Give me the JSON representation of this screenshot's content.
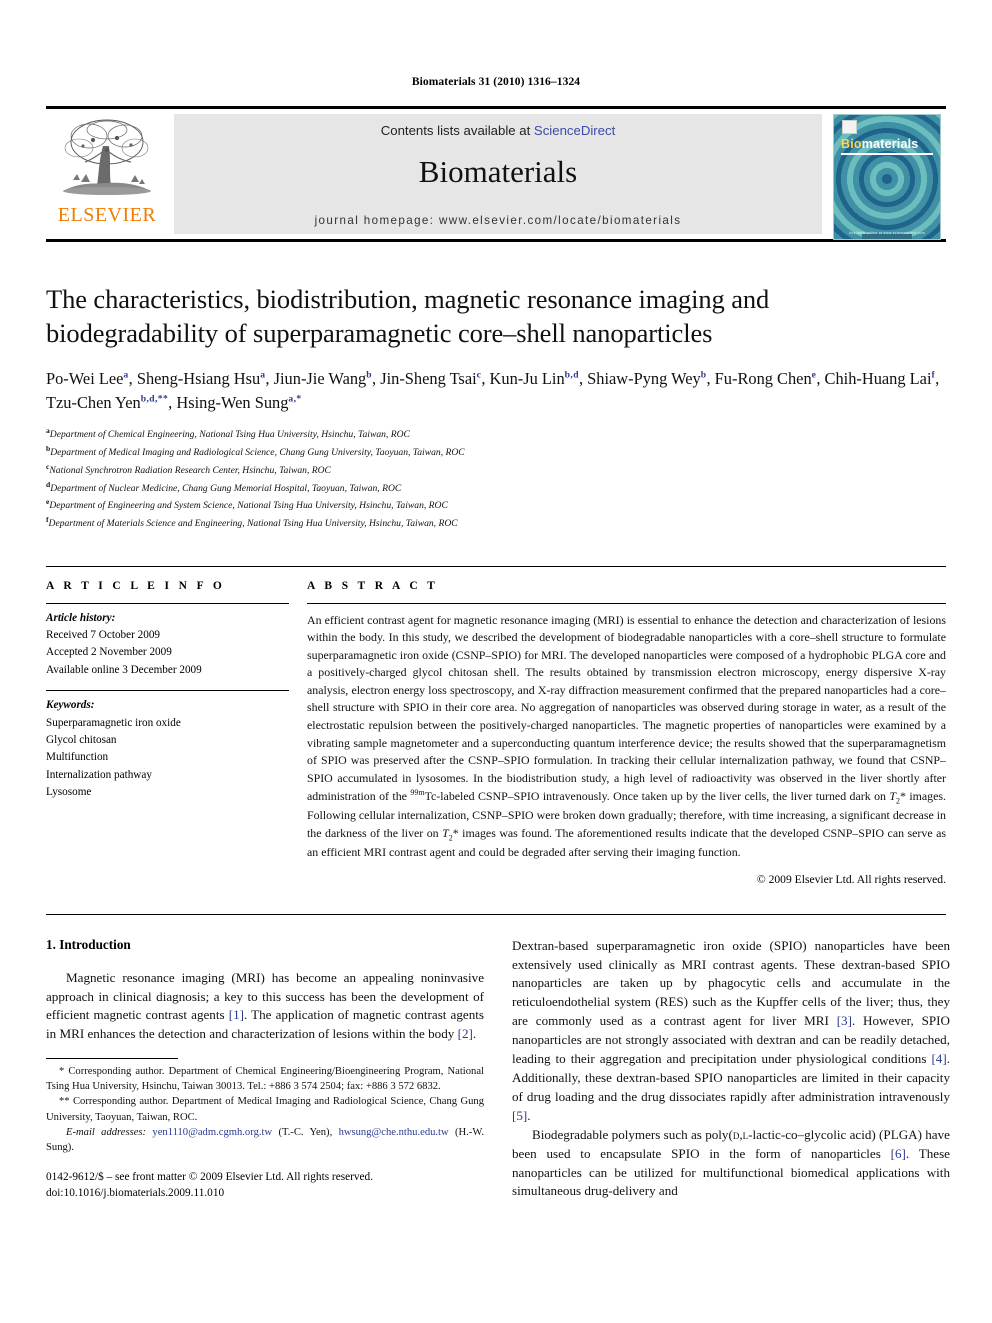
{
  "running_head": "Biomaterials 31 (2010) 1316–1324",
  "masthead": {
    "elsevier_label": "ELSEVIER",
    "contents_prefix": "Contents lists available at ",
    "sciencedirect": "ScienceDirect",
    "journal_name": "Biomaterials",
    "homepage": "journal homepage: www.elsevier.com/locate/biomaterials",
    "cover_title_bi": "Bio",
    "cover_title_rest": "materials",
    "cover_footer": "Available online at www.sciencedirect.com",
    "link_color": "#3b4ba8",
    "elsevier_orange": "#f07d00",
    "banner_bg": "#e6e6e6",
    "cover_teal": "#4aa3a8"
  },
  "title": "The characteristics, biodistribution, magnetic resonance imaging and biodegradability of superparamagnetic core–shell nanoparticles",
  "authors": [
    {
      "name": "Po-Wei Lee",
      "sup": "a",
      "sep": ", "
    },
    {
      "name": "Sheng-Hsiang Hsu",
      "sup": "a",
      "sep": ", "
    },
    {
      "name": "Jiun-Jie Wang",
      "sup": "b",
      "sep": ", "
    },
    {
      "name": "Jin-Sheng Tsai",
      "sup": "c",
      "sep": ", "
    },
    {
      "name": "Kun-Ju Lin",
      "sup": "b,d",
      "sep": ", "
    },
    {
      "name": "Shiaw-Pyng Wey",
      "sup": "b",
      "sep": ", "
    },
    {
      "name": "Fu-Rong Chen",
      "sup": "e",
      "sep": ", "
    },
    {
      "name": "Chih-Huang Lai",
      "sup": "f",
      "sep": ", "
    },
    {
      "name": "Tzu-Chen Yen",
      "sup": "b,d,**",
      "sep": ", "
    },
    {
      "name": "Hsing-Wen Sung",
      "sup": "a,*",
      "sep": ""
    }
  ],
  "affiliations": [
    {
      "mark": "a",
      "text": "Department of Chemical Engineering, National Tsing Hua University, Hsinchu, Taiwan, ROC"
    },
    {
      "mark": "b",
      "text": "Department of Medical Imaging and Radiological Science, Chang Gung University, Taoyuan, Taiwan, ROC"
    },
    {
      "mark": "c",
      "text": "National Synchrotron Radiation Research Center, Hsinchu, Taiwan, ROC"
    },
    {
      "mark": "d",
      "text": "Department of Nuclear Medicine, Chang Gung Memorial Hospital, Taoyuan, Taiwan, ROC"
    },
    {
      "mark": "e",
      "text": "Department of Engineering and System Science, National Tsing Hua University, Hsinchu, Taiwan, ROC"
    },
    {
      "mark": "f",
      "text": "Department of Materials Science and Engineering, National Tsing Hua University, Hsinchu, Taiwan, ROC"
    }
  ],
  "article_info": {
    "heading": "A R T I C L E  I N F O",
    "history_label": "Article history:",
    "history": [
      "Received 7 October 2009",
      "Accepted 2 November 2009",
      "Available online 3 December 2009"
    ],
    "keywords_label": "Keywords:",
    "keywords": [
      "Superparamagnetic iron oxide",
      "Glycol chitosan",
      "Multifunction",
      "Internalization pathway",
      "Lysosome"
    ]
  },
  "abstract": {
    "heading": "A B S T R A C T",
    "text": "An efficient contrast agent for magnetic resonance imaging (MRI) is essential to enhance the detection and characterization of lesions within the body. In this study, we described the development of biodegradable nanoparticles with a core–shell structure to formulate superparamagnetic iron oxide (CSNP–SPIO) for MRI. The developed nanoparticles were composed of a hydrophobic PLGA core and a positively-charged glycol chitosan shell. The results obtained by transmission electron microscopy, energy dispersive X-ray analysis, electron energy loss spectroscopy, and X-ray diffraction measurement confirmed that the prepared nanoparticles had a core–shell structure with SPIO in their core area. No aggregation of nanoparticles was observed during storage in water, as a result of the electrostatic repulsion between the positively-charged nanoparticles. The magnetic properties of nanoparticles were examined by a vibrating sample magnetometer and a superconducting quantum interference device; the results showed that the superparamagnetism of SPIO was preserved after the CSNP–SPIO formulation. In tracking their cellular internalization pathway, we found that CSNP–SPIO accumulated in lysosomes. In the biodistribution study, a high level of radioactivity was observed in the liver shortly after administration of the 99mTc-labeled CSNP–SPIO intravenously. Once taken up by the liver cells, the liver turned dark on T2* images. Following cellular internalization, CSNP–SPIO were broken down gradually; therefore, with time increasing, a significant decrease in the darkness of the liver on T2* images was found. The aforementioned results indicate that the developed CSNP–SPIO can serve as an efficient MRI contrast agent and could be degraded after serving their imaging function.",
    "copyright": "© 2009 Elsevier Ltd. All rights reserved."
  },
  "introduction": {
    "section_number_title": "1. Introduction",
    "left_paragraph": "Magnetic resonance imaging (MRI) has become an appealing noninvasive approach in clinical diagnosis; a key to this success has been the development of efficient magnetic contrast agents [1]. The application of magnetic contrast agents in MRI enhances the detection and characterization of lesions within the body [2].",
    "right_paragraph_1": "Dextran-based superparamagnetic iron oxide (SPIO) nanoparticles have been extensively used clinically as MRI contrast agents. These dextran-based SPIO nanoparticles are taken up by phagocytic cells and accumulate in the reticuloendothelial system (RES) such as the Kupffer cells of the liver; thus, they are commonly used as a contrast agent for liver MRI [3]. However, SPIO nanoparticles are not strongly associated with dextran and can be readily detached, leading to their aggregation and precipitation under physiological conditions [4]. Additionally, these dextran-based SPIO nanoparticles are limited in their capacity of drug loading and the drug dissociates rapidly after administration intravenously [5].",
    "right_paragraph_2": "Biodegradable polymers such as poly(D,L-lactic-co–glycolic acid) (PLGA) have been used to encapsulate SPIO in the form of nanoparticles [6]. These nanoparticles can be utilized for multifunctional biomedical applications with simultaneous drug-delivery and"
  },
  "footnotes": {
    "corresponding_1": "* Corresponding author. Department of Chemical Engineering/Bioengineering Program, National Tsing Hua University, Hsinchu, Taiwan 30013. Tel.: +886 3 574 2504; fax: +886 3 572 6832.",
    "corresponding_2": "** Corresponding author. Department of Medical Imaging and Radiological Science, Chang Gung University, Taoyuan, Taiwan, ROC.",
    "email_label": "E-mail addresses:",
    "email_1": "yen1110@adm.cgmh.org.tw",
    "email_1_owner": "(T.-C. Yen),",
    "email_2": "hwsung@che.nthu.edu.tw",
    "email_2_owner": "(H.-W. Sung).",
    "issn_line": "0142-9612/$ – see front matter © 2009 Elsevier Ltd. All rights reserved.",
    "doi_line": "doi:10.1016/j.biomaterials.2009.11.010"
  }
}
